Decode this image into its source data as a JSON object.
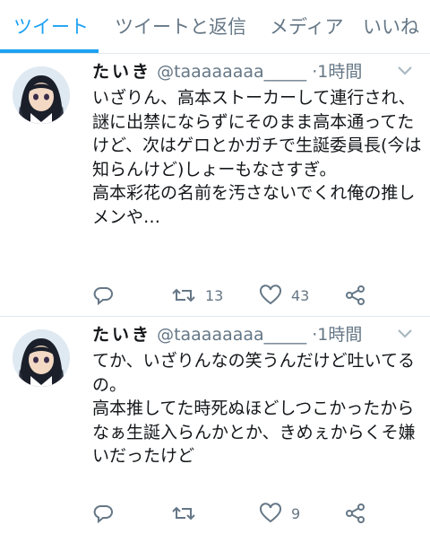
{
  "tabs": [
    {
      "label": "ツイート",
      "active": true
    },
    {
      "label": "ツイートと返信",
      "active": false
    },
    {
      "label": "メディア",
      "active": false
    },
    {
      "label": "いいね",
      "active": false
    }
  ],
  "colors": {
    "accent": "#1da1f2",
    "secondary_text": "#657786",
    "divider": "#e1e8ed"
  },
  "tweets": [
    {
      "name": "たいき",
      "handle": "@taaaaaaaa_____",
      "separator": "·",
      "time": "1時間",
      "text": "いざりん、高本ストーカーして連行され、謎に出禁にならずにそのまま高本通ってたけど、次はゲロとかガチで生誕委員長(今は知らんけど)しょーもなさすぎ。\n高本彩花の名前を汚さないでくれ俺の推しメンや…",
      "replies": "",
      "retweets": "13",
      "likes": "43",
      "icons": {
        "reply": "reply-icon",
        "retweet": "retweet-icon",
        "like": "heart-icon",
        "share": "share-icon",
        "menu": "chevron-down-icon"
      }
    },
    {
      "name": "たいき",
      "handle": "@taaaaaaaa_____",
      "separator": "·",
      "time": "1時間",
      "text": "てか、いざりんなの笑うんだけど吐いてるの。\n高本推してた時死ぬほどしつこかったからなぁ生誕入らんかとか、きめぇからくそ嫌いだったけど",
      "replies": "",
      "retweets": "",
      "likes": "9",
      "icons": {
        "reply": "reply-icon",
        "retweet": "retweet-icon",
        "like": "heart-icon",
        "share": "share-icon",
        "menu": "chevron-down-icon"
      }
    }
  ]
}
